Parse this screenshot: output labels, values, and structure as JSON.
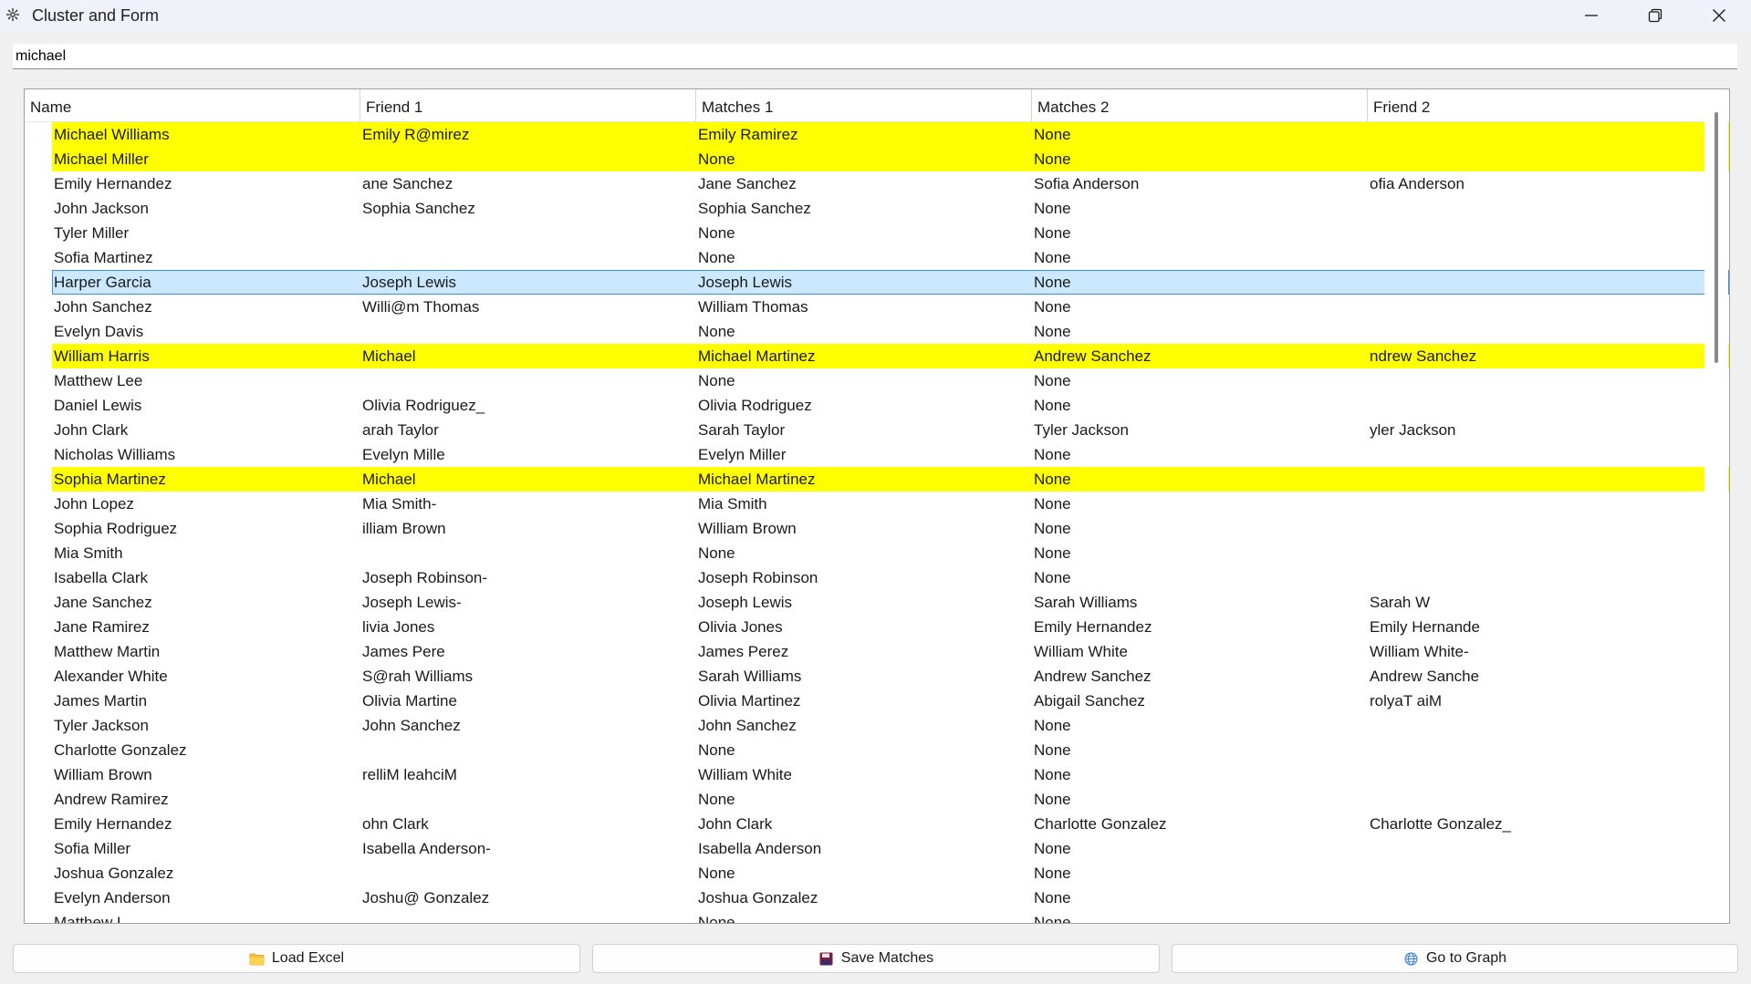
{
  "window": {
    "title": "Cluster and Form"
  },
  "search": {
    "value": "michael",
    "placeholder": ""
  },
  "table": {
    "headers": [
      "Name",
      "Friend 1",
      "Matches 1",
      "Matches 2",
      "Friend 2"
    ],
    "rows": [
      {
        "cells": [
          "Michael Williams",
          "Emily R@mirez",
          "Emily Ramirez",
          "None",
          ""
        ],
        "state": "highlight"
      },
      {
        "cells": [
          "Michael Miller",
          "",
          "None",
          "None",
          ""
        ],
        "state": "highlight"
      },
      {
        "cells": [
          "Emily Hernandez",
          "ane Sanchez",
          "Jane Sanchez",
          "Sofia Anderson",
          "ofia Anderson"
        ],
        "state": ""
      },
      {
        "cells": [
          "John Jackson",
          "Sophia Sanchez",
          "Sophia Sanchez",
          "None",
          ""
        ],
        "state": ""
      },
      {
        "cells": [
          "Tyler Miller",
          "",
          "None",
          "None",
          ""
        ],
        "state": ""
      },
      {
        "cells": [
          "Sofia Martinez",
          "",
          "None",
          "None",
          ""
        ],
        "state": ""
      },
      {
        "cells": [
          "Harper Garcia",
          "Joseph Lewis",
          "Joseph Lewis",
          "None",
          ""
        ],
        "state": "selected"
      },
      {
        "cells": [
          "John Sanchez",
          "Willi@m Thomas",
          "William Thomas",
          "None",
          ""
        ],
        "state": ""
      },
      {
        "cells": [
          "Evelyn Davis",
          "",
          "None",
          "None",
          ""
        ],
        "state": ""
      },
      {
        "cells": [
          "William Harris",
          "Michael",
          "Michael Martinez",
          "Andrew Sanchez",
          "ndrew Sanchez"
        ],
        "state": "highlight"
      },
      {
        "cells": [
          "Matthew Lee",
          "",
          "None",
          "None",
          ""
        ],
        "state": ""
      },
      {
        "cells": [
          "Daniel Lewis",
          "Olivia Rodriguez_",
          "Olivia Rodriguez",
          "None",
          ""
        ],
        "state": ""
      },
      {
        "cells": [
          "John Clark",
          "arah Taylor",
          "Sarah Taylor",
          "Tyler Jackson",
          "yler Jackson"
        ],
        "state": ""
      },
      {
        "cells": [
          "Nicholas Williams",
          "Evelyn Mille",
          "Evelyn Miller",
          "None",
          ""
        ],
        "state": ""
      },
      {
        "cells": [
          "Sophia Martinez",
          "Michael",
          "Michael Martinez",
          "None",
          ""
        ],
        "state": "highlight"
      },
      {
        "cells": [
          "John Lopez",
          "Mia Smith-",
          "Mia Smith",
          "None",
          ""
        ],
        "state": ""
      },
      {
        "cells": [
          "Sophia Rodriguez",
          "illiam Brown",
          "William Brown",
          "None",
          ""
        ],
        "state": ""
      },
      {
        "cells": [
          "Mia Smith",
          "",
          "None",
          "None",
          ""
        ],
        "state": ""
      },
      {
        "cells": [
          "Isabella Clark",
          "Joseph Robinson-",
          "Joseph Robinson",
          "None",
          ""
        ],
        "state": ""
      },
      {
        "cells": [
          "Jane Sanchez",
          "Joseph Lewis-",
          "Joseph Lewis",
          "Sarah Williams",
          "Sarah W"
        ],
        "state": ""
      },
      {
        "cells": [
          "Jane Ramirez",
          "livia Jones",
          "Olivia Jones",
          "Emily Hernandez",
          "Emily Hernande"
        ],
        "state": ""
      },
      {
        "cells": [
          "Matthew Martin",
          "James Pere",
          "James Perez",
          "William White",
          "William White-"
        ],
        "state": ""
      },
      {
        "cells": [
          "Alexander White",
          "S@rah Williams",
          "Sarah Williams",
          "Andrew Sanchez",
          "Andrew Sanche"
        ],
        "state": ""
      },
      {
        "cells": [
          "James Martin",
          "Olivia Martine",
          "Olivia Martinez",
          "Abigail Sanchez",
          "rolyaT aiM"
        ],
        "state": ""
      },
      {
        "cells": [
          "Tyler Jackson",
          "John Sanchez",
          "John Sanchez",
          "None",
          ""
        ],
        "state": ""
      },
      {
        "cells": [
          "Charlotte Gonzalez",
          "",
          "None",
          "None",
          ""
        ],
        "state": ""
      },
      {
        "cells": [
          "William Brown",
          "relliM leahciM",
          "William White",
          "None",
          ""
        ],
        "state": ""
      },
      {
        "cells": [
          "Andrew Ramirez",
          "",
          "None",
          "None",
          ""
        ],
        "state": ""
      },
      {
        "cells": [
          "Emily Hernandez",
          "ohn Clark",
          "John Clark",
          "Charlotte Gonzalez",
          "Charlotte Gonzalez_"
        ],
        "state": ""
      },
      {
        "cells": [
          "Sofia Miller",
          "Isabella Anderson-",
          "Isabella Anderson",
          "None",
          ""
        ],
        "state": ""
      },
      {
        "cells": [
          "Joshua Gonzalez",
          "",
          "None",
          "None",
          ""
        ],
        "state": ""
      },
      {
        "cells": [
          "Evelyn Anderson",
          "Joshu@ Gonzalez",
          "Joshua Gonzalez",
          "None",
          ""
        ],
        "state": ""
      },
      {
        "cells": [
          "Matthew L",
          "",
          "None",
          "None",
          ""
        ],
        "state": ""
      }
    ]
  },
  "buttons": {
    "load": {
      "label": "Load Excel",
      "icon": "folder-icon"
    },
    "save": {
      "label": "Save Matches",
      "icon": "floppy-disk-icon"
    },
    "graph": {
      "label": "Go to Graph",
      "icon": "globe-icon"
    }
  },
  "colors": {
    "highlight_row": "#ffff00",
    "selected_row": "#cce8ff",
    "selected_border": "#3d8ee0"
  }
}
